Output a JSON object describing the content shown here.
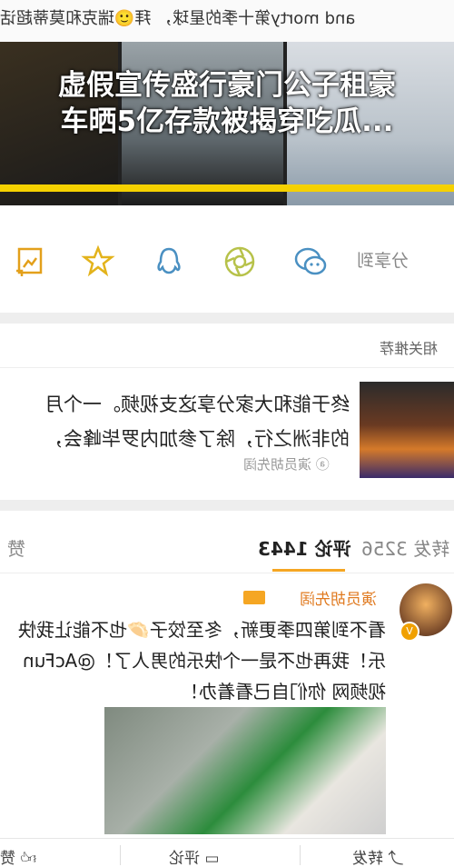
{
  "top_strip": {
    "text": "and morty第十季的星球， 拜🙂瑞克和莫蒂超话"
  },
  "banner": {
    "title_line1": "虚假宣传盛行豪门公子租豪",
    "title_line2": "车晒5亿存款被揭穿吃瓜..."
  },
  "share": {
    "label": "分享到",
    "icons": [
      "wechat-icon",
      "moments-icon",
      "qq-icon",
      "favorite-icon",
      "save-image-icon"
    ]
  },
  "related": {
    "header": "相关推荐",
    "text_line1": "终于能和大家分享这支视频。一个月",
    "text_line2": "的非洲之行，除了参加内罗毕峰会，",
    "author": "演员胡先阔"
  },
  "tabs": {
    "repost": "转发 3256",
    "comment": "评论 1443",
    "like": "赞"
  },
  "comment": {
    "author": "演员胡先阔",
    "text_line1": "看不到第四季更新，冬至饺子🥟也不能让我快",
    "text_line2": "乐！我再也不是一个快乐的男人了！@AcFun",
    "text_line3": "视频网 你们自己看着办！"
  },
  "bottom_bar": {
    "repost": "转发",
    "comment": "评论",
    "like": "赞"
  },
  "colors": {
    "accent": "#f5d100",
    "orange": "#f5a623",
    "name": "#e07a20"
  }
}
